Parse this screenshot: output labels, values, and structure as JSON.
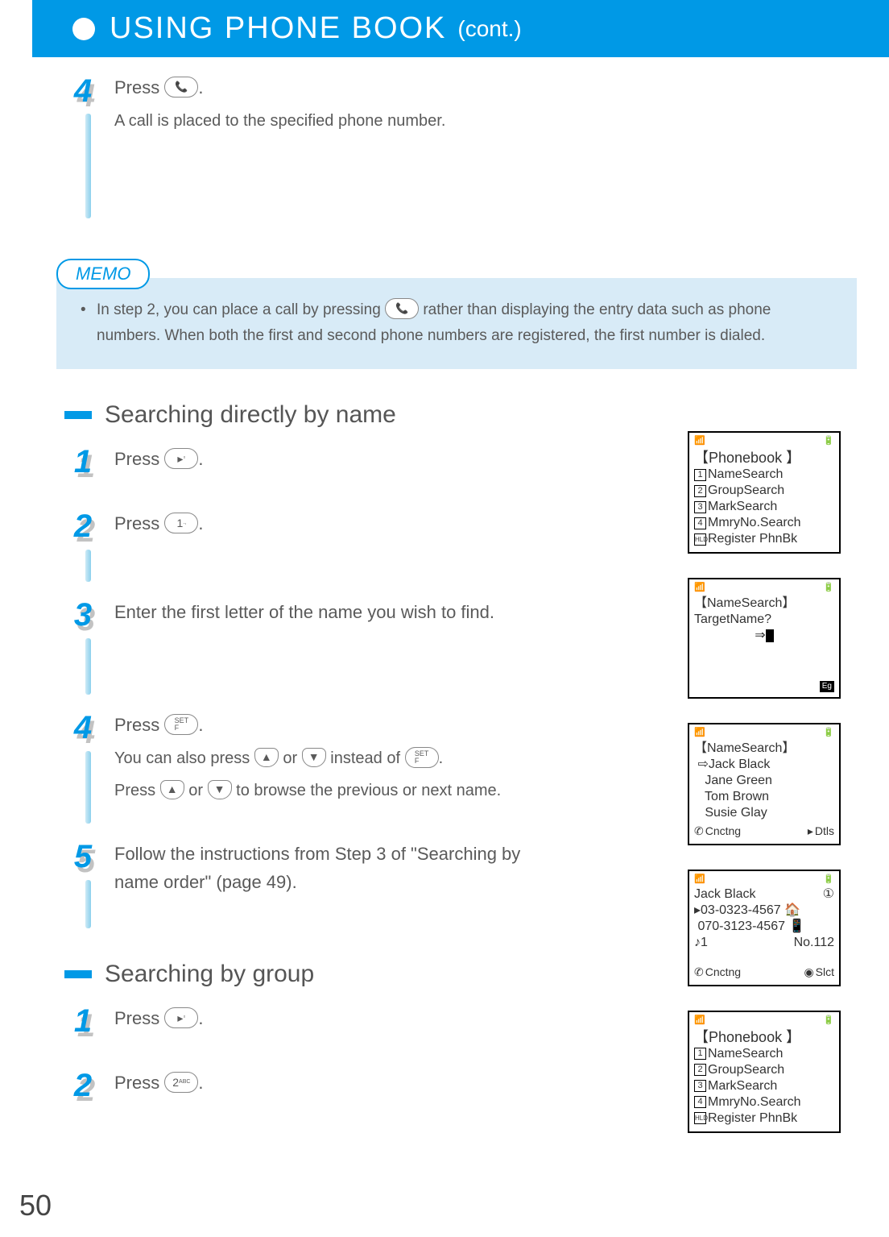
{
  "header": {
    "title": "USING PHONE BOOK",
    "cont": "(cont.)"
  },
  "step4_top": {
    "num": "4",
    "line1_a": "Press ",
    "line1_b": ".",
    "line2": "A call is placed to the specified phone number."
  },
  "memo": {
    "label": "MEMO",
    "text_a": "In step 2, you can place a call by pressing ",
    "text_b": " rather than displaying the entry data such as phone numbers. When both the first and second phone numbers are registered, the first number is dialed."
  },
  "section_name": "Searching directly by name",
  "name_steps": {
    "s1": {
      "num": "1",
      "line": "Press ",
      "end": "."
    },
    "s2": {
      "num": "2",
      "line": "Press ",
      "end": "."
    },
    "s3": {
      "num": "3",
      "line": "Enter the first letter of the name you wish to find."
    },
    "s4": {
      "num": "4",
      "l1a": "Press ",
      "l1b": ".",
      "l2a": "You can also press ",
      "l2b": " or ",
      "l2c": " instead of ",
      "l2d": ".",
      "l3a": "Press ",
      "l3b": " or ",
      "l3c": " to browse the previous or next name."
    },
    "s5": {
      "num": "5",
      "line": "Follow the instructions from Step 3 of \"Searching by name order\" (page 49)."
    }
  },
  "section_group": "Searching by group",
  "group_steps": {
    "s1": {
      "num": "1",
      "line": "Press ",
      "end": "."
    },
    "s2": {
      "num": "2",
      "line": "Press ",
      "end": "."
    }
  },
  "screens": {
    "phonebook_menu": {
      "title": "【Phonebook 】",
      "items": [
        "NameSearch",
        "GroupSearch",
        "MarkSearch",
        "MmryNo.Search",
        "Register PhnBk"
      ]
    },
    "namesearch_input": {
      "title": "【NameSearch】",
      "prompt": "TargetName?",
      "eg": "Eg"
    },
    "namesearch_list": {
      "title": "【NameSearch】",
      "items": [
        "Jack Black",
        "Jane Green",
        "Tom Brown",
        "Susie Glay"
      ],
      "footer_left": "Cnctng",
      "footer_right": "Dtls"
    },
    "detail": {
      "name": "Jack Black",
      "num_icon": "①",
      "phone1": "03-0323-4567",
      "phone2": "070-3123-4567",
      "ring": "1",
      "memno": "No.112",
      "footer_left": "Cnctng",
      "footer_right": "Slct"
    }
  },
  "page_number": "50",
  "keys": {
    "call": "↗",
    "right": "▸",
    "one": "1",
    "set": "SET\nF",
    "up": "▲",
    "down": "▼",
    "two": "2ABC"
  }
}
